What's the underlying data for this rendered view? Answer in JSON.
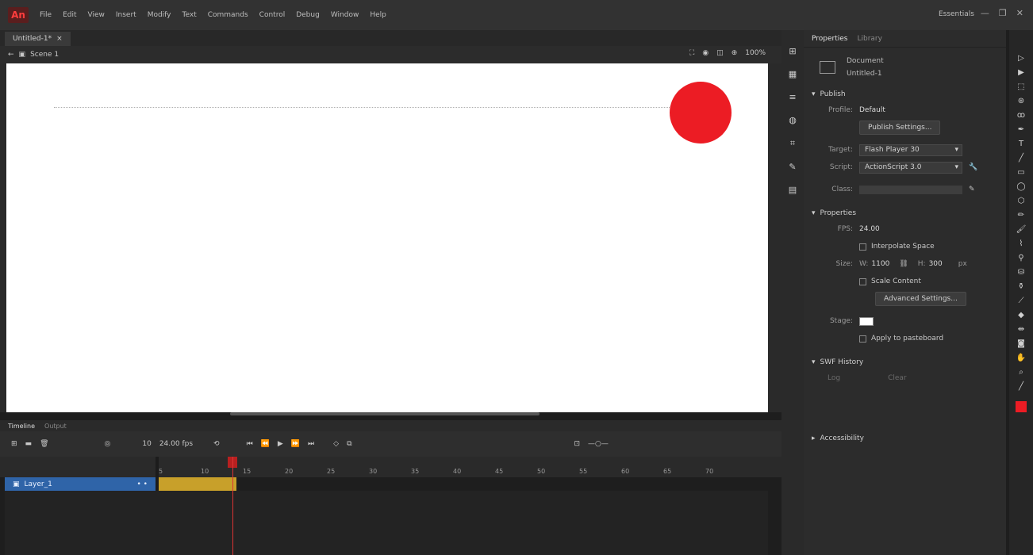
{
  "app": {
    "logo": "An"
  },
  "menu": [
    "File",
    "Edit",
    "View",
    "Insert",
    "Modify",
    "Text",
    "Commands",
    "Control",
    "Debug",
    "Window",
    "Help"
  ],
  "workspace": "Essentials",
  "window_controls": [
    "—",
    "❐",
    "✕"
  ],
  "document": {
    "tab_label": "Untitled-1*",
    "scene": "Scene 1",
    "zoom": "100%"
  },
  "props": {
    "tabs": [
      "Properties",
      "Library"
    ],
    "doc_type": "Document",
    "doc_name": "Untitled-1",
    "publish_section": "Publish",
    "profile_label": "Profile:",
    "profile_value": "Default",
    "publish_settings": "Publish Settings...",
    "target_label": "Target:",
    "target_value": "Flash Player 30",
    "script_label": "Script:",
    "script_value": "ActionScript 3.0",
    "class_label": "Class:",
    "properties_section": "Properties",
    "fps_label": "FPS:",
    "fps_value": "24.00",
    "interpolate": "Interpolate Space",
    "size_label": "Size:",
    "w_label": "W:",
    "w_value": "1100",
    "h_label": "H:",
    "h_value": "300",
    "px": "px",
    "scale_content": "Scale Content",
    "advanced_settings": "Advanced Settings...",
    "stage_label": "Stage:",
    "apply_pasteboard": "Apply to pasteboard",
    "swf_section": "SWF History",
    "log": "Log",
    "clear": "Clear",
    "accessibility_section": "Accessibility"
  },
  "timeline": {
    "tabs": [
      "Timeline",
      "Output"
    ],
    "fps": "24.00 fps",
    "frame": "10",
    "layer_name": "Layer_1",
    "ruler": [
      "",
      "5",
      "10",
      "15",
      "20",
      "25",
      "30",
      "35",
      "40",
      "45",
      "50",
      "55",
      "60",
      "65",
      "70"
    ]
  },
  "colors": {
    "ball": "#ec1c24",
    "stage": "#ffffff",
    "layer_highlight": "#2f64a8",
    "frame_span": "#c8a02a"
  }
}
